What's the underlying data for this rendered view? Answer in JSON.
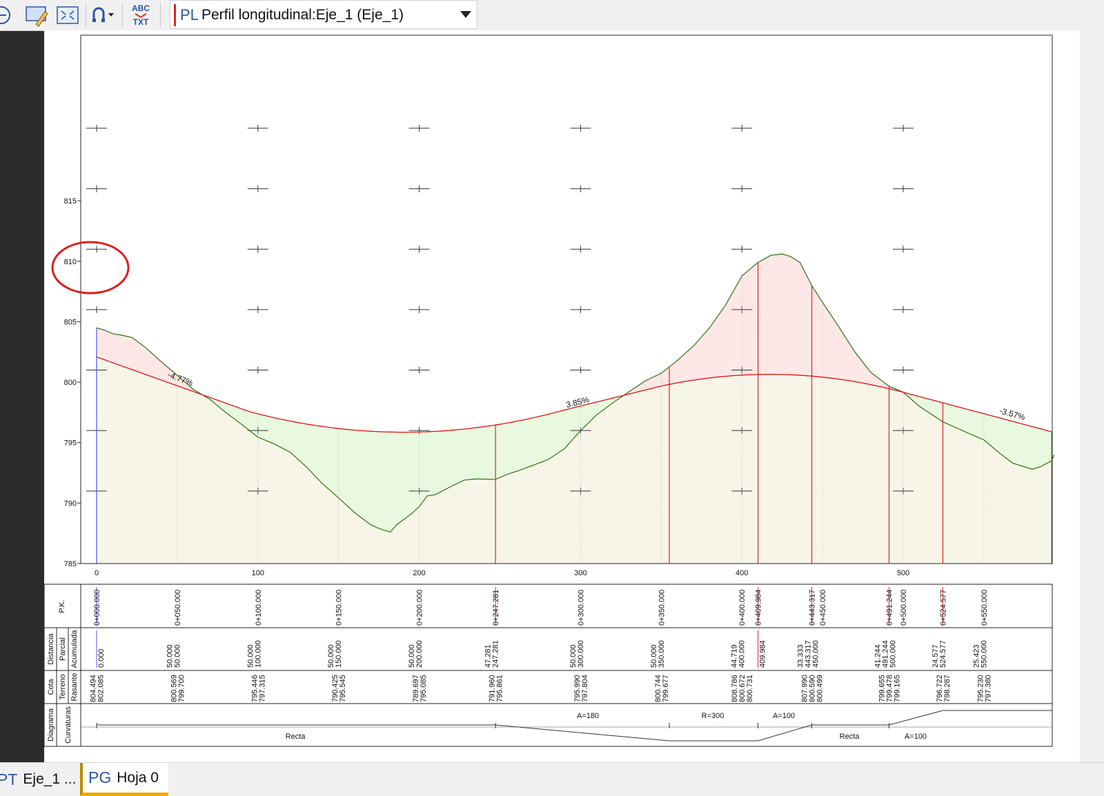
{
  "toolbar": {
    "abc_label": "ABC",
    "txt_label": "TXT",
    "view_prefix": "PL",
    "view_title": "Perfil longitudinal:Eje_1 (Eje_1)",
    "icons": [
      "zoom-out-icon",
      "edit-pencil-icon",
      "fit-extents-icon",
      "snap-magnet-icon",
      "text-style-icon",
      "dropdown-arrow-icon"
    ]
  },
  "tabs": [
    {
      "prefix": "PT",
      "label": "Eje_1 ..."
    },
    {
      "prefix": "PG",
      "label": "Hoja 0",
      "active": true
    }
  ],
  "profile": {
    "y_ticks": [
      785,
      790,
      795,
      800,
      805,
      810,
      815
    ],
    "x_ticks": [
      0,
      100,
      200,
      300,
      400,
      500
    ],
    "slopes": [
      "-4.77%",
      "3.85%",
      "-3.57%"
    ],
    "terrain": [
      [
        0,
        804.49
      ],
      [
        5,
        804.3
      ],
      [
        10,
        804
      ],
      [
        15,
        803.9
      ],
      [
        22,
        803.7
      ],
      [
        30,
        802.9
      ],
      [
        40,
        801.7
      ],
      [
        50,
        800.57
      ],
      [
        60,
        799.4
      ],
      [
        70,
        798.6
      ],
      [
        80,
        797.5
      ],
      [
        90,
        796.5
      ],
      [
        100,
        795.45
      ],
      [
        110,
        794.9
      ],
      [
        120,
        794.2
      ],
      [
        130,
        793
      ],
      [
        140,
        791.6
      ],
      [
        150,
        790.43
      ],
      [
        160,
        789.2
      ],
      [
        170,
        788.2
      ],
      [
        175,
        787.9
      ],
      [
        182,
        787.6
      ],
      [
        186,
        788.2
      ],
      [
        195,
        789.1
      ],
      [
        200,
        789.7
      ],
      [
        205,
        790.6
      ],
      [
        210,
        790.7
      ],
      [
        220,
        791.4
      ],
      [
        228,
        791.9
      ],
      [
        235,
        792
      ],
      [
        247.28,
        791.96
      ],
      [
        255,
        792.4
      ],
      [
        262,
        792.7
      ],
      [
        270,
        793.1
      ],
      [
        280,
        793.6
      ],
      [
        290,
        794.5
      ],
      [
        300,
        795.99
      ],
      [
        310,
        797.3
      ],
      [
        320,
        798.3
      ],
      [
        330,
        799.2
      ],
      [
        340,
        800.1
      ],
      [
        350,
        800.74
      ],
      [
        360,
        801.8
      ],
      [
        370,
        803
      ],
      [
        380,
        804.5
      ],
      [
        390,
        806.4
      ],
      [
        400,
        808.79
      ],
      [
        409.98,
        809.9
      ],
      [
        418,
        810.5
      ],
      [
        425,
        810.6
      ],
      [
        430,
        810.4
      ],
      [
        436,
        809.9
      ],
      [
        443.32,
        807.99
      ],
      [
        450,
        806.6
      ],
      [
        460,
        804.6
      ],
      [
        470,
        802.5
      ],
      [
        480,
        800.8
      ],
      [
        491.24,
        799.66
      ],
      [
        500,
        799.17
      ],
      [
        510,
        798
      ],
      [
        524.58,
        796.72
      ],
      [
        530,
        796.4
      ],
      [
        540,
        795.8
      ],
      [
        550,
        795.23
      ],
      [
        560,
        794.1
      ],
      [
        568,
        793.3
      ],
      [
        580,
        792.8
      ],
      [
        585,
        793
      ],
      [
        592,
        793.5
      ]
    ],
    "grade_end_x": 592,
    "grade_end_y": 795.9,
    "axis_max_x": 592,
    "marker_rows": [
      791,
      796,
      801,
      806,
      811,
      816,
      821
    ],
    "red_stations": [
      0,
      247.281,
      355,
      409.984,
      443.317,
      491.244,
      524.577
    ],
    "grey_stations": [
      50,
      100,
      150,
      200,
      300,
      350,
      400,
      450,
      500,
      550
    ]
  },
  "band": {
    "row_labels": {
      "pk": "P.K.",
      "distancia": "Distancia",
      "parcial": "Parcial",
      "acumulada": "Acumulada",
      "cota": "Cota",
      "terreno": "Terreno",
      "rasante": "Rasante",
      "diagrama": "Diagrama",
      "curvaturas": "Curvaturas"
    },
    "pk_entries": [
      {
        "x": 0,
        "text": "0+000.000",
        "red": true
      },
      {
        "x": 50,
        "text": "0+050.000"
      },
      {
        "x": 100,
        "text": "0+100.000"
      },
      {
        "x": 150,
        "text": "0+150.000"
      },
      {
        "x": 200,
        "text": "0+200.000"
      },
      {
        "x": 247.281,
        "text": "0+247.281",
        "red": true
      },
      {
        "x": 300,
        "text": "0+300.000"
      },
      {
        "x": 350,
        "text": "0+350.000"
      },
      {
        "x": 400,
        "text": "0+400.000"
      },
      {
        "x": 409.984,
        "text": "0+409.984",
        "red": true
      },
      {
        "x": 443.317,
        "text": "0+443.317",
        "red": true
      },
      {
        "x": 450,
        "text": "0+450.000"
      },
      {
        "x": 491.244,
        "text": "0+491.244",
        "red": true
      },
      {
        "x": 500,
        "text": "0+500.000"
      },
      {
        "x": 524.577,
        "text": "0+524.577",
        "red": true
      },
      {
        "x": 550,
        "text": "0+550.000"
      }
    ],
    "dist_entries": [
      {
        "x": 0,
        "texts": [
          "0.000"
        ]
      },
      {
        "x": 50,
        "texts": [
          "50.000",
          "50.000"
        ]
      },
      {
        "x": 100,
        "texts": [
          "50.000",
          "100.000"
        ]
      },
      {
        "x": 150,
        "texts": [
          "50.000",
          "150.000"
        ]
      },
      {
        "x": 200,
        "texts": [
          "50.000",
          "200.000"
        ]
      },
      {
        "x": 247.281,
        "texts": [
          "47.281",
          "247.281"
        ]
      },
      {
        "x": 300,
        "texts": [
          "50.000",
          "300.000"
        ]
      },
      {
        "x": 350,
        "texts": [
          "50.000",
          "350.000"
        ]
      },
      {
        "x": 400,
        "texts": [
          "44.719",
          "400.000"
        ]
      },
      {
        "x": 409.984,
        "texts": [
          "409.984"
        ]
      },
      {
        "x": 443.317,
        "texts": [
          "33.333",
          "443.317",
          "450.000"
        ]
      },
      {
        "x": 491.244,
        "texts": [
          "41.244",
          "491.244",
          "500.000"
        ]
      },
      {
        "x": 524.577,
        "texts": [
          "24.577",
          "524.577"
        ]
      },
      {
        "x": 550,
        "texts": [
          "25.423",
          "550.000"
        ]
      }
    ],
    "cota_entries": [
      {
        "x": 0,
        "texts": [
          "804.494",
          "802.085"
        ]
      },
      {
        "x": 50,
        "texts": [
          "800.569",
          "799.700"
        ]
      },
      {
        "x": 100,
        "texts": [
          "795.446",
          "797.315"
        ]
      },
      {
        "x": 150,
        "texts": [
          "790.425",
          "795.545"
        ]
      },
      {
        "x": 200,
        "texts": [
          "789.697",
          "795.085"
        ]
      },
      {
        "x": 247.281,
        "texts": [
          "791.960",
          "795.861"
        ]
      },
      {
        "x": 300,
        "texts": [
          "795.990",
          "797.804"
        ]
      },
      {
        "x": 350,
        "texts": [
          "800.744",
          "799.677"
        ]
      },
      {
        "x": 400,
        "texts": [
          "808.786",
          "800.672",
          "800.731"
        ]
      },
      {
        "x": 443.317,
        "texts": [
          "807.990",
          "800.590",
          "800.499"
        ]
      },
      {
        "x": 491.244,
        "texts": [
          "799.655",
          "799.478",
          "799.165"
        ]
      },
      {
        "x": 524.577,
        "texts": [
          "796.722",
          "798.287"
        ]
      },
      {
        "x": 550,
        "texts": [
          "795.230",
          "797.380"
        ]
      }
    ],
    "curv_labels": [
      "A=180",
      "R=300",
      "A=100",
      "Recta",
      "Recta",
      "A=100"
    ]
  }
}
